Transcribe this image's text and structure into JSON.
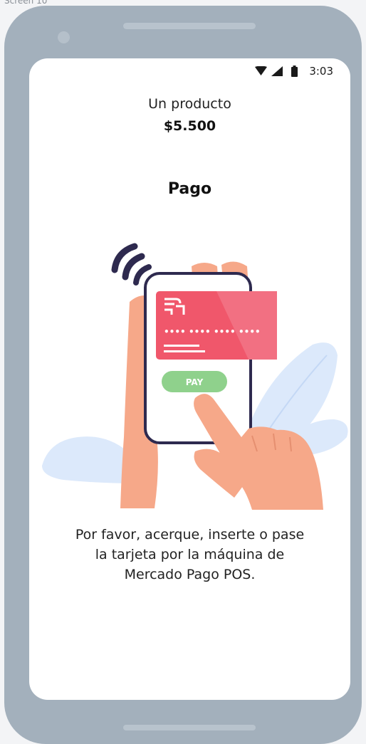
{
  "screen_label": "Screen 10",
  "status_bar": {
    "time": "3:03",
    "icons": [
      "wifi-icon",
      "signal-icon",
      "battery-icon"
    ]
  },
  "order": {
    "product": "Un producto",
    "price": "$5.500"
  },
  "section_title": "Pago",
  "illustration": {
    "pay_button_label": "PAY",
    "card_number_groups": [
      "••••",
      "••••",
      "••••",
      "••••"
    ]
  },
  "instructions": {
    "line1": "Por favor, acerque, inserte o pase",
    "line2": "la tarjeta por la máquina de",
    "line3": "Mercado Pago POS."
  },
  "colors": {
    "frame": "#a3b0bc",
    "card": "#f0576b",
    "pay_button": "#8fd18c",
    "skin": "#f6a889",
    "leaves": "#dce9fb"
  }
}
